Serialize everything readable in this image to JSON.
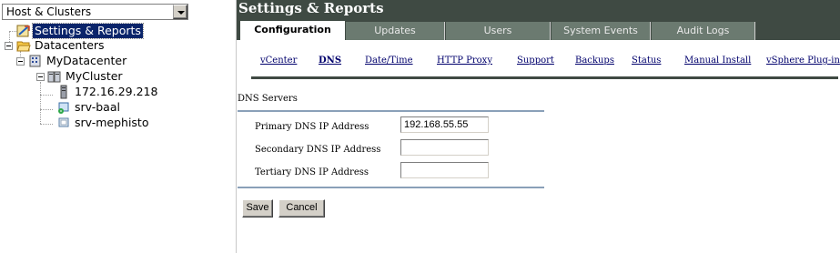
{
  "left_pane": {
    "view_select": {
      "value": "Host & Clusters"
    },
    "tree": {
      "settings_reports": "Settings & Reports",
      "datacenters": "Datacenters",
      "my_datacenter": "MyDatacenter",
      "my_cluster": "MyCluster",
      "host_ip": "172.16.29.218",
      "vm_baal": "srv-baal",
      "vm_mephisto": "srv-mephisto"
    }
  },
  "header": {
    "title": "Settings & Reports"
  },
  "tabs": [
    "Configuration",
    "Updates",
    "Users",
    "System Events",
    "Audit Logs"
  ],
  "subnav": [
    "vCenter",
    "DNS",
    "Date/Time",
    "HTTP Proxy",
    "Support",
    "Backups",
    "Status",
    "Manual Install",
    "vSphere Plug-in"
  ],
  "dns_form": {
    "section_title": "DNS Servers",
    "primary_label": "Primary DNS IP Address",
    "primary_value": "192.168.55.55",
    "secondary_label": "Secondary DNS IP Address",
    "secondary_value": "",
    "tertiary_label": "Tertiary DNS IP Address",
    "tertiary_value": ""
  },
  "buttons": {
    "save": "Save",
    "cancel": "Cancel"
  },
  "colors": {
    "header_bg": "#3f4a43",
    "tab_bg": "#6b7a70",
    "selection": "#0a246a",
    "link": "#00006c"
  }
}
